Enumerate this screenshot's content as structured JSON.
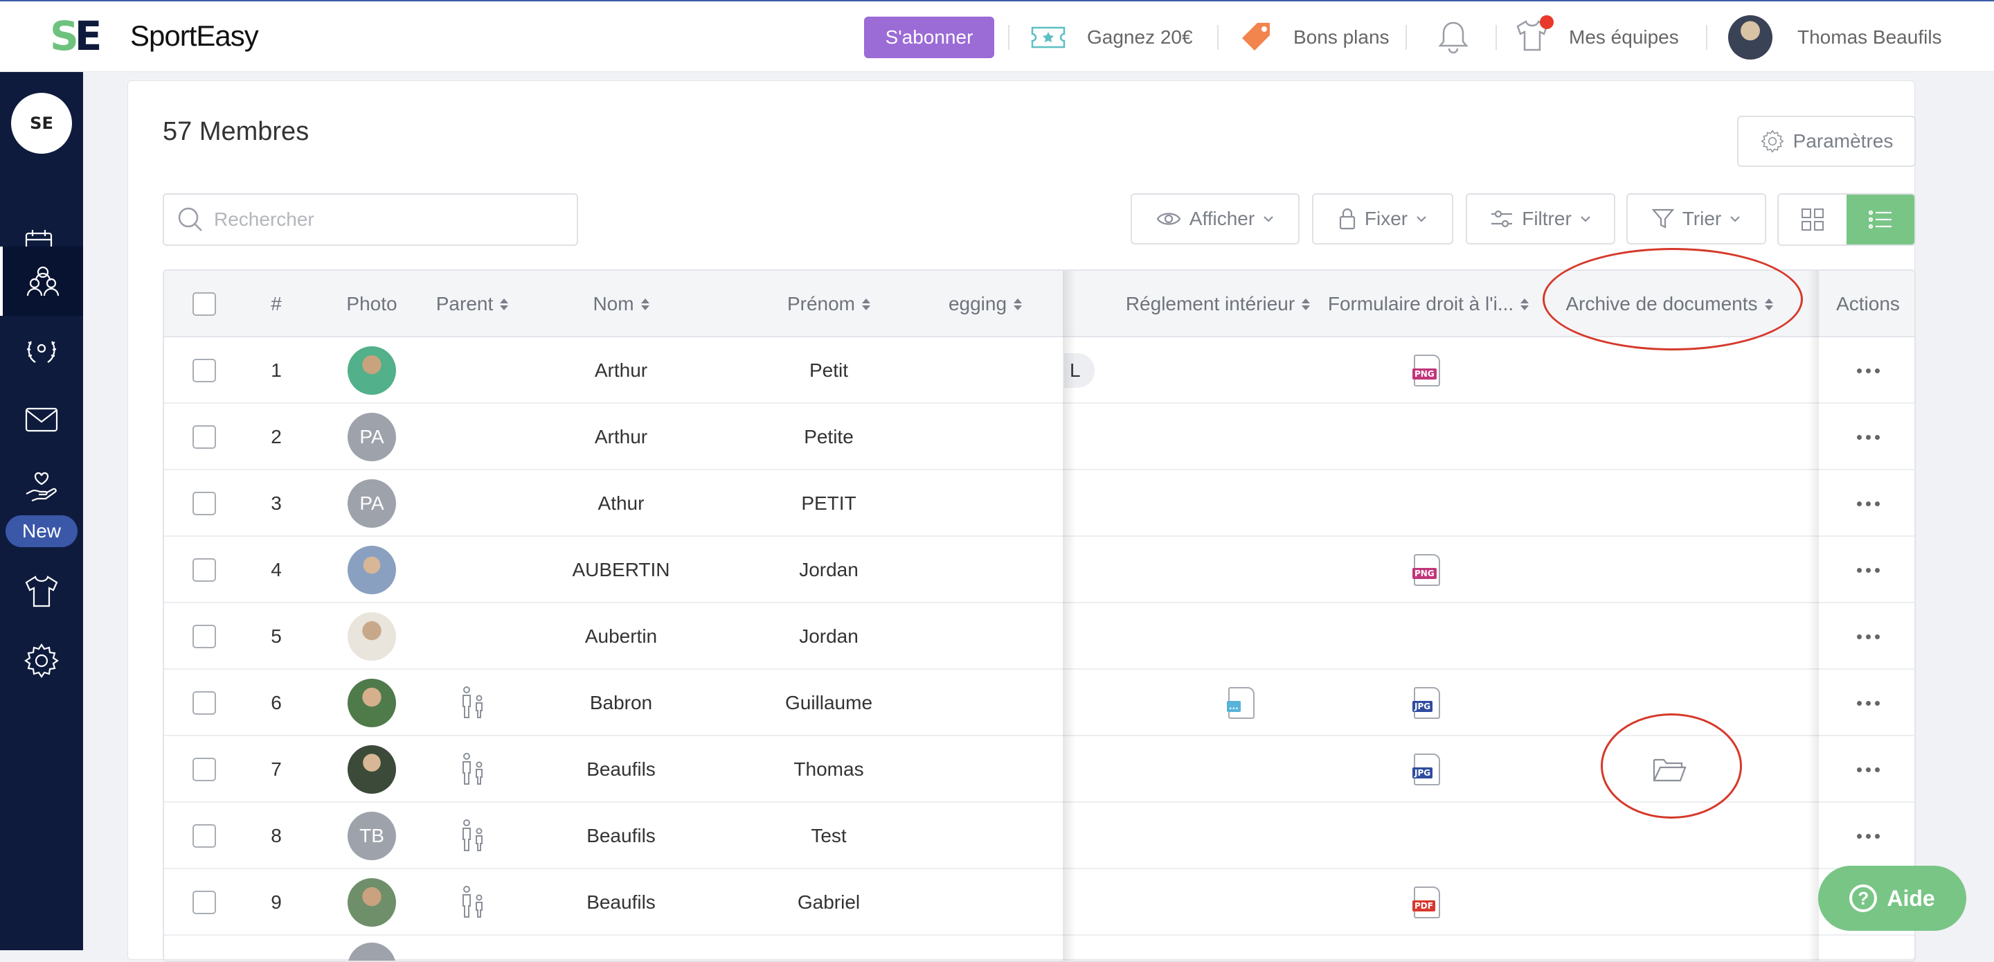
{
  "topbar": {
    "brand": "SportEasy",
    "logo_mark": "SE",
    "subscribe": "S'abonner",
    "earn": "Gagnez 20€",
    "deals": "Bons plans",
    "teams": "Mes équipes",
    "user": "Thomas Beaufils"
  },
  "sidebar": {
    "logo": "SE",
    "new_badge": "New",
    "icons": [
      "calendar-icon",
      "members-icon",
      "laurel-icon",
      "mail-icon",
      "hand-heart-icon",
      "jersey-icon",
      "gear-icon"
    ]
  },
  "main": {
    "title": "57 Membres",
    "settings": "Paramètres",
    "search_placeholder": "Rechercher",
    "show": "Afficher",
    "pin": "Fixer",
    "filter": "Filtrer",
    "sort": "Trier"
  },
  "table": {
    "headers": {
      "num": "#",
      "photo": "Photo",
      "parent": "Parent",
      "nom": "Nom",
      "prenom": "Prénom",
      "partial": "egging",
      "reglement": "Réglement intérieur",
      "formulaire": "Formulaire droit à l'i...",
      "archive": "Archive de documents",
      "actions": "Actions"
    },
    "rows": [
      {
        "num": "1",
        "nom": "Arthur",
        "prenom": "Petit",
        "initials": "",
        "parent": false,
        "pill": "L",
        "reglement": "",
        "formulaire": "PNG",
        "archive": false
      },
      {
        "num": "2",
        "nom": "Arthur",
        "prenom": "Petite",
        "initials": "PA",
        "parent": false,
        "pill": "",
        "reglement": "",
        "formulaire": "",
        "archive": false
      },
      {
        "num": "3",
        "nom": "Athur",
        "prenom": "PETIT",
        "initials": "PA",
        "parent": false,
        "pill": "",
        "reglement": "",
        "formulaire": "",
        "archive": false
      },
      {
        "num": "4",
        "nom": "AUBERTIN",
        "prenom": "Jordan",
        "initials": "",
        "parent": false,
        "pill": "",
        "reglement": "",
        "formulaire": "PNG",
        "archive": false
      },
      {
        "num": "5",
        "nom": "Aubertin",
        "prenom": "Jordan",
        "initials": "",
        "parent": false,
        "pill": "",
        "reglement": "",
        "formulaire": "",
        "archive": false
      },
      {
        "num": "6",
        "nom": "Babron",
        "prenom": "Guillaume",
        "initials": "",
        "parent": true,
        "pill": "",
        "reglement": "...",
        "formulaire": "JPG",
        "archive": false
      },
      {
        "num": "7",
        "nom": "Beaufils",
        "prenom": "Thomas",
        "initials": "",
        "parent": true,
        "pill": "",
        "reglement": "",
        "formulaire": "JPG",
        "archive": true
      },
      {
        "num": "8",
        "nom": "Beaufils",
        "prenom": "Test",
        "initials": "TB",
        "parent": true,
        "pill": "",
        "reglement": "",
        "formulaire": "",
        "archive": false
      },
      {
        "num": "9",
        "nom": "Beaufils",
        "prenom": "Gabriel",
        "initials": "",
        "parent": true,
        "pill": "",
        "reglement": "",
        "formulaire": "PDF",
        "archive": false
      }
    ]
  },
  "help": "Aide",
  "colors": {
    "accent_green": "#79c586",
    "subscribe_purple": "#9b6bd6",
    "sidebar": "#0e1b3d",
    "annotation_red": "#d6392b"
  }
}
